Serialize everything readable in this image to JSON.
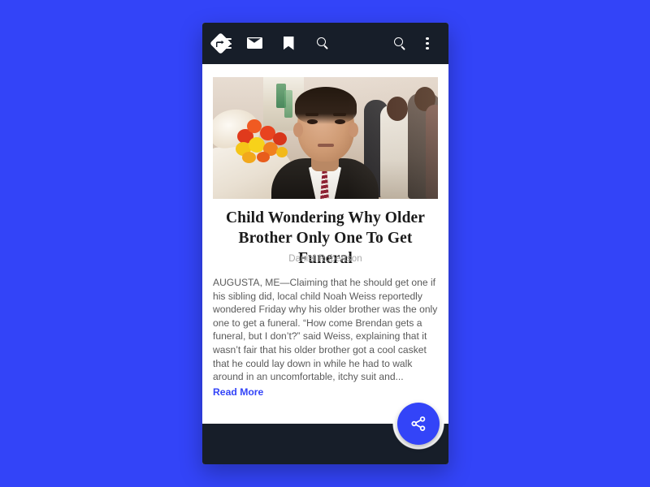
{
  "background_color": "#3344f8",
  "app_bar": {
    "background_color": "#171e29",
    "menu_icon": "hamburger-menu-icon",
    "search_icon": "search-icon",
    "overflow_icon": "more-vert-icon"
  },
  "article": {
    "photo_alt": "Young boy in a dark suit and tie standing in front of a casket with red and yellow flowers while mourners gather in the background",
    "title": "Child Wondering Why Older Brother Only One To Get Funeral",
    "author": "Daniel Robertson",
    "body": "AUGUSTA, ME—Claiming that he should get one if his sibling did, local child Noah Weiss reportedly wondered Friday why his older brother was the only one to get a funeral. “How come Brendan gets a funeral, but I don’t?” said Weiss, explaining that it wasn’t fair that his older brother got a cool casket that he could lay down in while he had to walk around in an uncomfortable, itchy suit and...",
    "read_more_label": "Read More",
    "read_more_color": "#3344f8"
  },
  "bottom_bar": {
    "background_color": "#171e29",
    "items": [
      {
        "name": "directions-icon",
        "label": "Directions"
      },
      {
        "name": "email-icon",
        "label": "Email"
      },
      {
        "name": "bookmark-icon",
        "label": "Bookmark"
      },
      {
        "name": "search-icon",
        "label": "Search"
      }
    ]
  },
  "fab": {
    "icon": "share-icon",
    "label": "Share",
    "color": "#3344f8"
  }
}
